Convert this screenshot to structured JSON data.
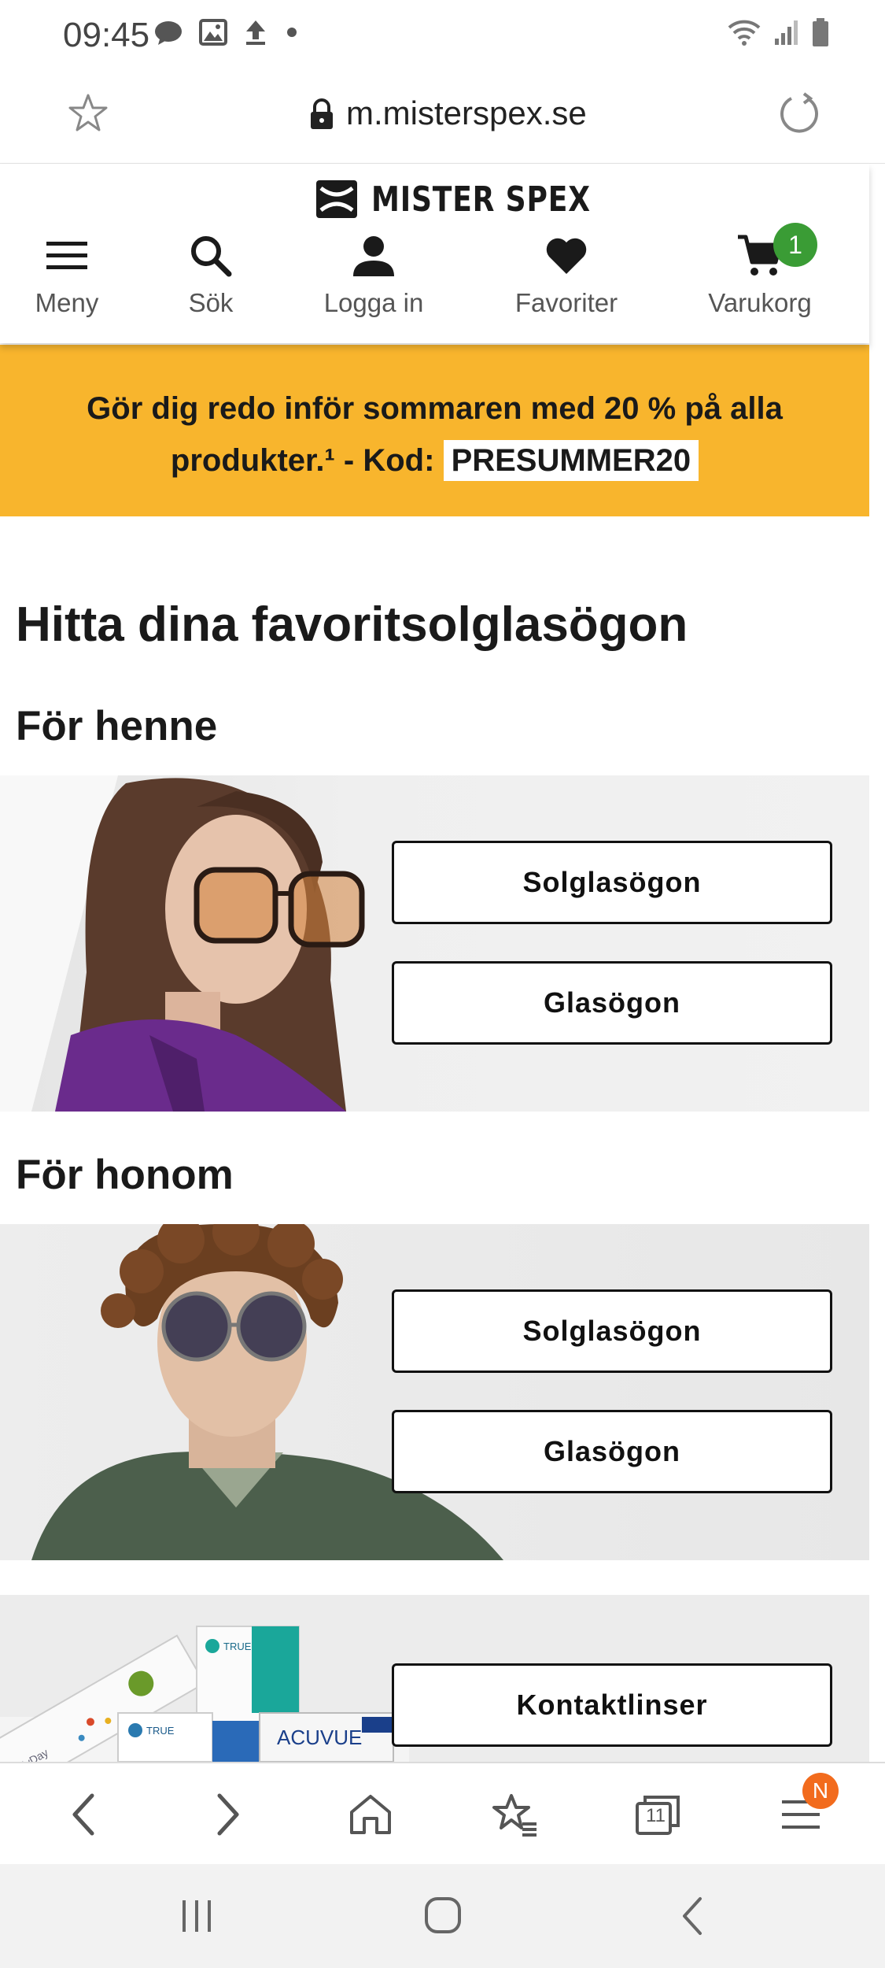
{
  "status_bar": {
    "time": "09:45"
  },
  "browser": {
    "url": "m.misterspex.se"
  },
  "header": {
    "logo_text": "MISTER SPEX",
    "nav": {
      "menu": "Meny",
      "search": "Sök",
      "login": "Logga in",
      "favorites": "Favoriter",
      "cart": "Varukorg"
    },
    "cart_count": "1"
  },
  "promo": {
    "text_line1": "Gör dig redo inför sommaren med 20 % på alla",
    "text_line2": "produkter.¹ - Kod:",
    "code": "PRESUMMER20"
  },
  "main": {
    "title": "Hitta dina favoritsolglasögon",
    "section_her": {
      "title": "För henne",
      "btn_sunglasses": "Solglasögon",
      "btn_glasses": "Glasögon"
    },
    "section_him": {
      "title": "För honom",
      "btn_sunglasses": "Solglasögon",
      "btn_glasses": "Glasögon"
    },
    "section_lenses": {
      "btn_contacts": "Kontaktlinser",
      "product_labels": [
        "TRUE",
        "TRUE",
        "ACUVUE",
        "MyDay"
      ]
    }
  },
  "bottom_toolbar": {
    "tabs_count": "11",
    "menu_badge": "N"
  },
  "colors": {
    "promo_bg": "#f8b52d",
    "cart_badge": "#3a9c35",
    "notification_badge": "#f26b1d"
  }
}
